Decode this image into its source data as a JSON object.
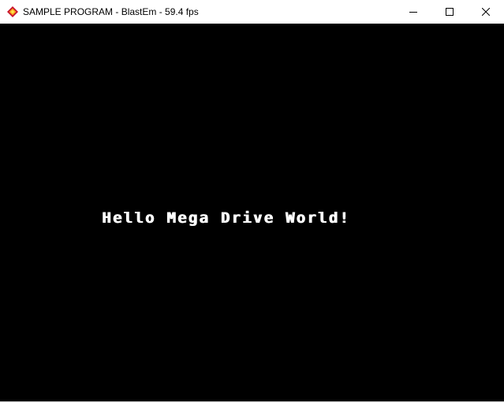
{
  "window": {
    "title": "SAMPLE PROGRAM - BlastEm - 59.4 fps",
    "icon": "blastem-app-icon",
    "controls": {
      "minimize": "minimize-icon",
      "maximize": "maximize-icon",
      "close": "close-icon"
    }
  },
  "screen": {
    "text": "Hello Mega Drive World!",
    "background_color": "#000000",
    "text_color": "#ffffff"
  }
}
